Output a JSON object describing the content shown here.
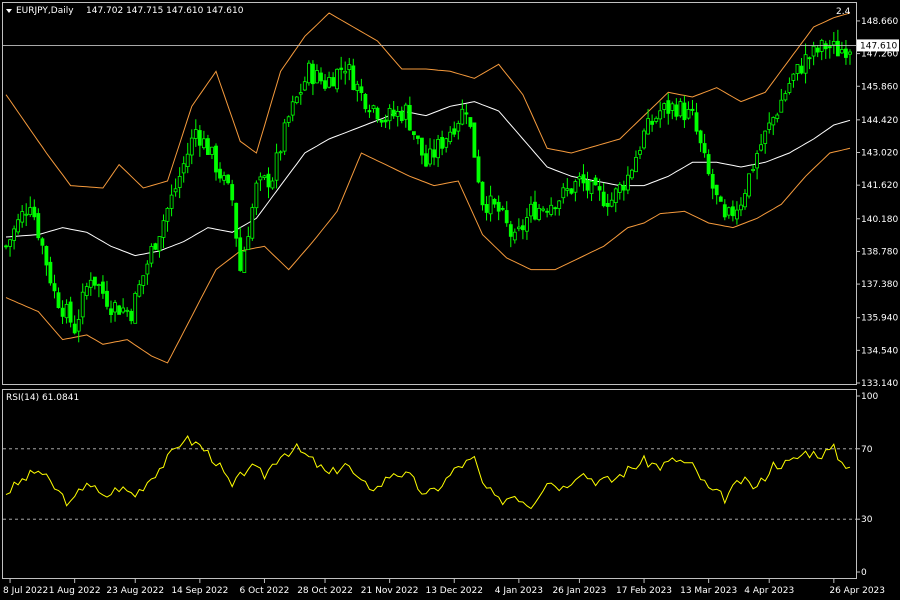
{
  "header": {
    "symbol_timeframe": "EURJPY,Daily",
    "ohlc": "147.702 147.715 147.610 147.610",
    "corner_glyph": "2.4"
  },
  "indicator": {
    "label": "RSI(14) 61.0841"
  },
  "colors": {
    "background": "#000000",
    "bull": "#00ff00",
    "bear": "#00ff00",
    "bands": "#f59a3c",
    "middle": "#ffffff",
    "rsi": "#ffff00",
    "frame": "#c0c0c0",
    "price_line": "#c0c0c0"
  },
  "chart_data": [
    {
      "type": "candlestick",
      "series_label": "EURJPY,Daily",
      "ylim": [
        133.14,
        149.3
      ],
      "y_ticks": [
        "148.660",
        "147.260",
        "145.860",
        "144.420",
        "143.020",
        "141.620",
        "140.180",
        "138.780",
        "137.380",
        "135.940",
        "134.540",
        "133.140"
      ],
      "current_price": "147.610",
      "x_ticks": [
        "8 Jul 2022",
        "1 Aug 2022",
        "23 Aug 2022",
        "14 Sep 2022",
        "6 Oct 2022",
        "28 Oct 2022",
        "21 Nov 2022",
        "13 Dec 2022",
        "4 Jan 2023",
        "26 Jan 2023",
        "17 Feb 2023",
        "13 Mar 2023",
        "4 Apr 2023",
        "26 Apr 2023"
      ],
      "bar_count": 210,
      "close_anchors": [
        [
          0,
          139.0
        ],
        [
          6,
          141.0
        ],
        [
          12,
          137.0
        ],
        [
          17,
          135.5
        ],
        [
          21,
          137.8
        ],
        [
          26,
          136.5
        ],
        [
          31,
          136.2
        ],
        [
          36,
          138.8
        ],
        [
          42,
          141.5
        ],
        [
          47,
          144.0
        ],
        [
          50,
          143.2
        ],
        [
          56,
          141.0
        ],
        [
          58,
          138.0
        ],
        [
          62,
          141.5
        ],
        [
          66,
          142.0
        ],
        [
          70,
          144.5
        ],
        [
          75,
          146.5
        ],
        [
          79,
          146.0
        ],
        [
          84,
          146.8
        ],
        [
          88,
          145.5
        ],
        [
          94,
          144.5
        ],
        [
          99,
          144.8
        ],
        [
          104,
          142.5
        ],
        [
          110,
          144.0
        ],
        [
          114,
          145.0
        ],
        [
          118,
          141.0
        ],
        [
          122,
          140.5
        ],
        [
          126,
          139.2
        ],
        [
          130,
          140.5
        ],
        [
          134,
          140.8
        ],
        [
          138,
          141.2
        ],
        [
          142,
          141.8
        ],
        [
          146,
          141.2
        ],
        [
          150,
          141.0
        ],
        [
          154,
          142.0
        ],
        [
          158,
          143.8
        ],
        [
          162,
          144.8
        ],
        [
          166,
          145.0
        ],
        [
          170,
          144.5
        ],
        [
          174,
          142.0
        ],
        [
          178,
          140.0
        ],
        [
          182,
          141.0
        ],
        [
          186,
          143.0
        ],
        [
          190,
          144.5
        ],
        [
          194,
          146.0
        ],
        [
          198,
          147.0
        ],
        [
          203,
          147.6
        ],
        [
          206,
          147.4
        ],
        [
          209,
          147.61
        ]
      ],
      "upper_band": [
        [
          0,
          145.5
        ],
        [
          10,
          143.0
        ],
        [
          16,
          141.6
        ],
        [
          24,
          141.5
        ],
        [
          28,
          142.5
        ],
        [
          34,
          141.5
        ],
        [
          40,
          141.8
        ],
        [
          46,
          145.0
        ],
        [
          52,
          146.5
        ],
        [
          58,
          143.5
        ],
        [
          62,
          143.0
        ],
        [
          68,
          146.5
        ],
        [
          74,
          148.0
        ],
        [
          80,
          149.0
        ],
        [
          86,
          148.4
        ],
        [
          92,
          147.8
        ],
        [
          98,
          146.6
        ],
        [
          104,
          146.6
        ],
        [
          110,
          146.5
        ],
        [
          116,
          146.2
        ],
        [
          122,
          146.8
        ],
        [
          128,
          145.5
        ],
        [
          134,
          143.2
        ],
        [
          140,
          143.0
        ],
        [
          146,
          143.3
        ],
        [
          152,
          143.6
        ],
        [
          158,
          144.6
        ],
        [
          164,
          145.6
        ],
        [
          170,
          145.4
        ],
        [
          176,
          145.8
        ],
        [
          182,
          145.2
        ],
        [
          188,
          145.6
        ],
        [
          194,
          147.0
        ],
        [
          200,
          148.4
        ],
        [
          205,
          148.8
        ],
        [
          209,
          149.0
        ]
      ],
      "lower_band": [
        [
          0,
          136.8
        ],
        [
          8,
          136.2
        ],
        [
          14,
          135.0
        ],
        [
          20,
          135.2
        ],
        [
          24,
          134.8
        ],
        [
          30,
          135.0
        ],
        [
          36,
          134.3
        ],
        [
          40,
          134.0
        ],
        [
          46,
          136.0
        ],
        [
          52,
          138.0
        ],
        [
          58,
          138.8
        ],
        [
          64,
          139.0
        ],
        [
          70,
          138.0
        ],
        [
          76,
          139.2
        ],
        [
          82,
          140.5
        ],
        [
          88,
          143.0
        ],
        [
          94,
          142.5
        ],
        [
          100,
          142.0
        ],
        [
          106,
          141.6
        ],
        [
          112,
          141.8
        ],
        [
          118,
          139.5
        ],
        [
          124,
          138.5
        ],
        [
          130,
          138.0
        ],
        [
          136,
          138.0
        ],
        [
          142,
          138.5
        ],
        [
          148,
          139.0
        ],
        [
          154,
          139.8
        ],
        [
          158,
          140.0
        ],
        [
          162,
          140.4
        ],
        [
          168,
          140.5
        ],
        [
          174,
          140.0
        ],
        [
          180,
          139.8
        ],
        [
          186,
          140.2
        ],
        [
          192,
          140.8
        ],
        [
          198,
          142.0
        ],
        [
          204,
          143.0
        ],
        [
          209,
          143.2
        ]
      ],
      "middle_band": [
        [
          0,
          139.4
        ],
        [
          8,
          139.5
        ],
        [
          14,
          139.8
        ],
        [
          20,
          139.6
        ],
        [
          26,
          139.0
        ],
        [
          32,
          138.6
        ],
        [
          38,
          138.8
        ],
        [
          44,
          139.2
        ],
        [
          50,
          139.8
        ],
        [
          56,
          139.6
        ],
        [
          62,
          140.2
        ],
        [
          68,
          141.6
        ],
        [
          74,
          143.0
        ],
        [
          80,
          143.6
        ],
        [
          86,
          144.0
        ],
        [
          92,
          144.4
        ],
        [
          98,
          144.8
        ],
        [
          104,
          144.6
        ],
        [
          110,
          145.0
        ],
        [
          116,
          145.2
        ],
        [
          122,
          144.8
        ],
        [
          128,
          143.6
        ],
        [
          134,
          142.4
        ],
        [
          140,
          142.0
        ],
        [
          146,
          141.8
        ],
        [
          152,
          141.6
        ],
        [
          158,
          141.6
        ],
        [
          164,
          142.0
        ],
        [
          170,
          142.6
        ],
        [
          176,
          142.6
        ],
        [
          182,
          142.4
        ],
        [
          188,
          142.6
        ],
        [
          194,
          143.0
        ],
        [
          200,
          143.6
        ],
        [
          205,
          144.2
        ],
        [
          209,
          144.4
        ]
      ]
    },
    {
      "type": "line",
      "series_label": "RSI(14) 61.0841",
      "ylim": [
        0,
        100
      ],
      "y_ticks": [
        "100",
        "70",
        "30",
        "0"
      ],
      "levels": [
        70,
        30
      ],
      "anchors": [
        [
          0,
          45
        ],
        [
          4,
          52
        ],
        [
          8,
          58
        ],
        [
          12,
          48
        ],
        [
          16,
          38
        ],
        [
          20,
          52
        ],
        [
          24,
          42
        ],
        [
          28,
          48
        ],
        [
          32,
          44
        ],
        [
          36,
          54
        ],
        [
          40,
          64
        ],
        [
          44,
          76
        ],
        [
          48,
          72
        ],
        [
          52,
          63
        ],
        [
          56,
          48
        ],
        [
          60,
          60
        ],
        [
          64,
          55
        ],
        [
          68,
          67
        ],
        [
          72,
          70
        ],
        [
          76,
          63
        ],
        [
          80,
          55
        ],
        [
          84,
          62
        ],
        [
          88,
          50
        ],
        [
          92,
          48
        ],
        [
          96,
          57
        ],
        [
          100,
          54
        ],
        [
          104,
          43
        ],
        [
          108,
          50
        ],
        [
          112,
          60
        ],
        [
          116,
          64
        ],
        [
          118,
          50
        ],
        [
          122,
          40
        ],
        [
          126,
          44
        ],
        [
          130,
          38
        ],
        [
          134,
          52
        ],
        [
          138,
          48
        ],
        [
          142,
          57
        ],
        [
          146,
          52
        ],
        [
          150,
          52
        ],
        [
          154,
          58
        ],
        [
          158,
          63
        ],
        [
          162,
          60
        ],
        [
          166,
          64
        ],
        [
          170,
          60
        ],
        [
          174,
          47
        ],
        [
          178,
          42
        ],
        [
          182,
          52
        ],
        [
          186,
          48
        ],
        [
          190,
          61
        ],
        [
          194,
          62
        ],
        [
          198,
          68
        ],
        [
          202,
          67
        ],
        [
          205,
          70
        ],
        [
          207,
          62
        ],
        [
          209,
          61.08
        ]
      ]
    }
  ]
}
